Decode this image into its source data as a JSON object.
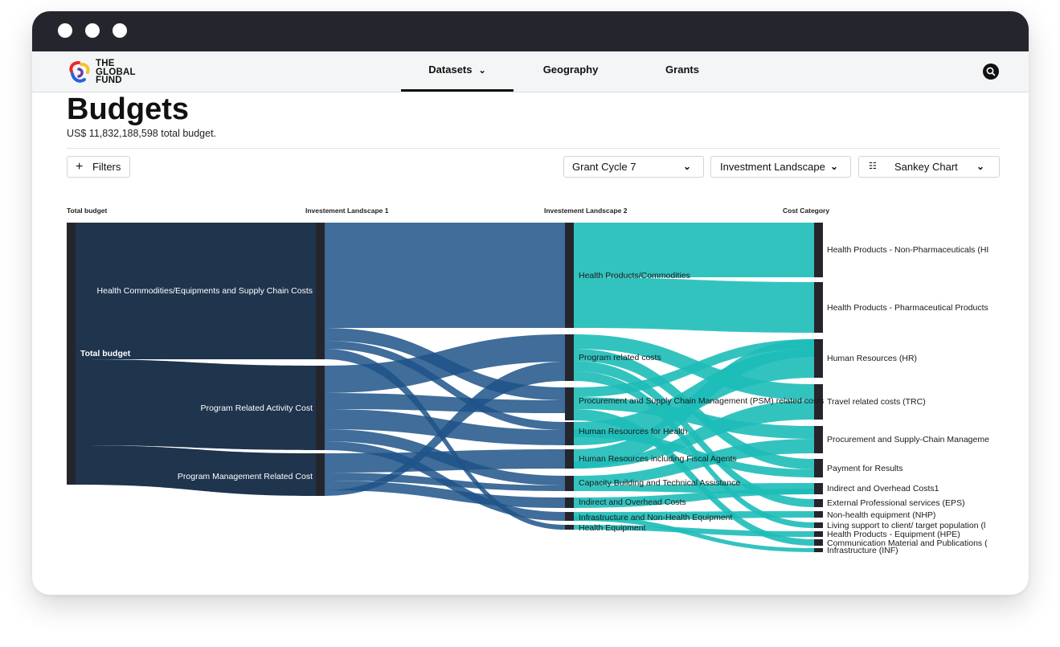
{
  "browser": {
    "dots": 3
  },
  "nav": {
    "logo_text": [
      "THE",
      "GLOBAL",
      "FUND"
    ],
    "links": [
      {
        "label": "Datasets",
        "active": true,
        "has_dropdown": true
      },
      {
        "label": "Geography",
        "active": false,
        "has_dropdown": false
      },
      {
        "label": "Grants",
        "active": false,
        "has_dropdown": false
      }
    ],
    "search_icon": "search-icon"
  },
  "page": {
    "title": "Budgets",
    "subtitle": "US$ 11,832,188,598 total budget."
  },
  "controls": {
    "filters_label": "Filters",
    "grant_cycle": "Grant Cycle 7",
    "investment": "Investment Landscape",
    "view": "Sankey Chart"
  },
  "colors": {
    "navy": "#1f344d",
    "blue": "#1f5488",
    "teal": "#1dbcb8",
    "bar": "#25262d"
  },
  "chart_data": {
    "type": "sankey",
    "columns": [
      "Total budget",
      "Investement Landscape 1",
      "Investement Landscape 2",
      "Cost Category"
    ],
    "nodes": {
      "level0": [
        "Total budget"
      ],
      "level1": [
        "Health Commodities/Equipments and Supply Chain Costs",
        "Program Related Activity Cost",
        "Program Management Related Cost"
      ],
      "level2": [
        "Health Products/Commodities",
        "Program related costs",
        "Procurement and Supply Chain Management (PSM) related costs",
        "Human Resources for Health",
        "Human Resources including Fiscal Agents",
        "Capacity Building and Technical Assistance",
        "Indirect and Overhead Costs",
        "Infrastructure and Non-Health Equipment",
        "Health Equipment"
      ],
      "level3": [
        "Health Products - Non-Pharmaceuticals (HI",
        "Health Products - Pharmaceutical Products",
        "Human Resources (HR)",
        "Travel related costs (TRC)",
        "Procurement and Supply-Chain Manageme",
        "Payment for Results",
        "Indirect and Overhead Costs1",
        "External Professional services (EPS)",
        "Non-health equipment (NHP)",
        "Living support to client/ target population (l",
        "Health Products - Equipment (HPE)",
        "Communication Material and Publications (",
        "Infrastructure (INF)"
      ]
    }
  }
}
